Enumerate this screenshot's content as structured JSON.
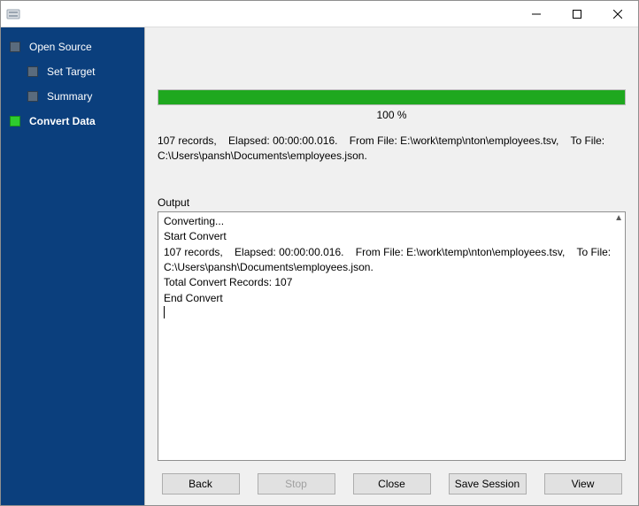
{
  "window": {
    "title": ""
  },
  "sidebar": {
    "items": [
      {
        "label": "Open Source",
        "active": false,
        "child": false
      },
      {
        "label": "Set Target",
        "active": false,
        "child": true
      },
      {
        "label": "Summary",
        "active": false,
        "child": true
      },
      {
        "label": "Convert Data",
        "active": true,
        "child": false
      }
    ]
  },
  "progress": {
    "percent": 100,
    "label": "100 %"
  },
  "status": "107 records,    Elapsed: 00:00:00.016.    From File: E:\\work\\temp\\nton\\employees.tsv,    To File: C:\\Users\\pansh\\Documents\\employees.json.",
  "output": {
    "label": "Output",
    "text": "Converting...\nStart Convert\n107 records,    Elapsed: 00:00:00.016.    From File: E:\\work\\temp\\nton\\employees.tsv,    To File: C:\\Users\\pansh\\Documents\\employees.json.\nTotal Convert Records: 107\nEnd Convert"
  },
  "buttons": {
    "back": "Back",
    "stop": "Stop",
    "close": "Close",
    "save": "Save Session",
    "view": "View"
  }
}
